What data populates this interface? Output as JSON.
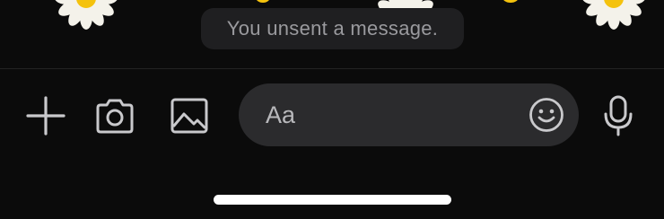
{
  "chat": {
    "system_message": "You unsent a message.",
    "decoration_icon": "daisy-icon"
  },
  "composer": {
    "add_icon": "plus-icon",
    "camera_icon": "camera-icon",
    "gallery_icon": "image-icon",
    "input_placeholder": "Aa",
    "input_value": "",
    "emoji_icon": "smiley-icon",
    "voice_icon": "microphone-icon"
  },
  "colors": {
    "background": "#0b0b0b",
    "pill_background": "#1f1f21",
    "pill_text": "#9a9a9e",
    "input_background": "#2b2b2d",
    "icon": "#c9c9cc",
    "daisy_petal": "#f4f2ea",
    "daisy_center": "#f4c20d"
  }
}
